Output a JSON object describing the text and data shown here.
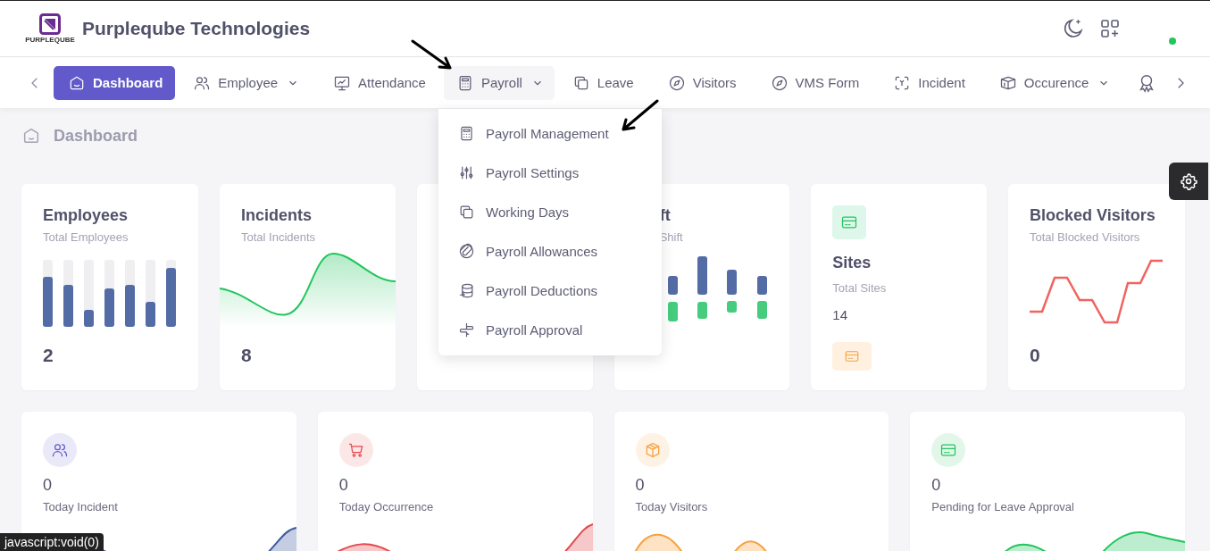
{
  "header": {
    "logo_text": "PURPLEQUBE",
    "title": "Purpleqube Technologies"
  },
  "nav": [
    {
      "label": "Dashboard",
      "selected": true,
      "has_menu": false,
      "expanded": false
    },
    {
      "label": "Employee",
      "selected": false,
      "has_menu": true,
      "expanded": false
    },
    {
      "label": "Attendance",
      "selected": false,
      "has_menu": false,
      "expanded": false
    },
    {
      "label": "Payroll",
      "selected": false,
      "has_menu": true,
      "expanded": true
    },
    {
      "label": "Leave",
      "selected": false,
      "has_menu": false,
      "expanded": false
    },
    {
      "label": "Visitors",
      "selected": false,
      "has_menu": false,
      "expanded": false
    },
    {
      "label": "VMS Form",
      "selected": false,
      "has_menu": false,
      "expanded": false
    },
    {
      "label": "Incident",
      "selected": false,
      "has_menu": false,
      "expanded": false
    },
    {
      "label": "Occurence",
      "selected": false,
      "has_menu": true,
      "expanded": false
    }
  ],
  "payroll_menu": [
    "Payroll Management",
    "Payroll Settings",
    "Working Days",
    "Payroll Allowances",
    "Payroll Deductions",
    "Payroll Approval"
  ],
  "breadcrumb": "Dashboard",
  "stat_cards": [
    {
      "kind": "bars",
      "title": "Employees",
      "subtitle": "Total Employees",
      "value": "2"
    },
    {
      "kind": "wave",
      "title": "Incidents",
      "subtitle": "Total Incidents",
      "value": "8"
    },
    {
      "kind": "covered"
    },
    {
      "kind": "shift",
      "title": "ft",
      "subtitle": "Shift"
    },
    {
      "kind": "sites",
      "title": "Sites",
      "subtitle": "Total Sites",
      "value": "14"
    },
    {
      "kind": "line",
      "title": "Blocked Visitors",
      "subtitle": "Total Blocked Visitors",
      "value": "0"
    }
  ],
  "today_cards": [
    {
      "value": "0",
      "label": "Today Incident",
      "color": "#6259ca"
    },
    {
      "value": "0",
      "label": "Today Occurrence",
      "color": "#e5484d"
    },
    {
      "value": "0",
      "label": "Today Visitors",
      "color": "#f7a03d"
    },
    {
      "value": "0",
      "label": "Pending for Leave Approval",
      "color": "#22c55e"
    }
  ],
  "status_url": "javascript:void(0)"
}
